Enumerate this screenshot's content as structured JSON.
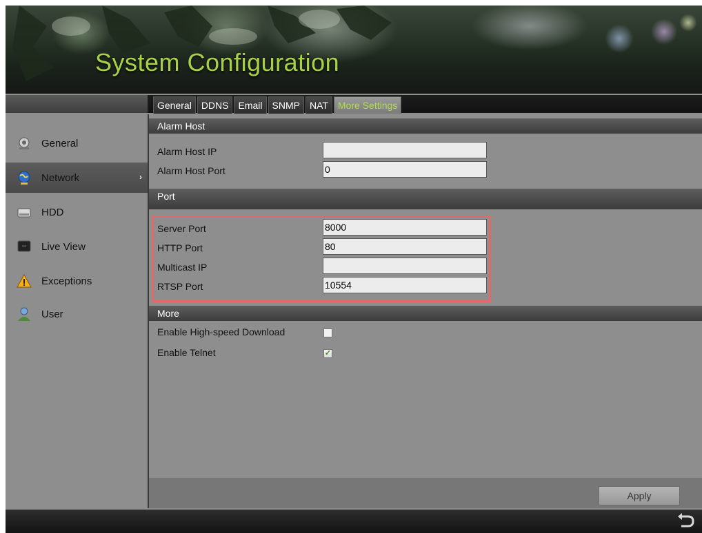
{
  "header": {
    "title": "System Configuration"
  },
  "tabs": [
    {
      "label": "General",
      "active": false
    },
    {
      "label": "DDNS",
      "active": false
    },
    {
      "label": "Email",
      "active": false
    },
    {
      "label": "SNMP",
      "active": false
    },
    {
      "label": "NAT",
      "active": false
    },
    {
      "label": "More Settings",
      "active": true
    }
  ],
  "sidebar": {
    "items": [
      {
        "label": "General",
        "icon": "camera-gear-icon",
        "active": false
      },
      {
        "label": "Network",
        "icon": "globe-icon",
        "active": true,
        "arrow": "›"
      },
      {
        "label": "HDD",
        "icon": "hdd-icon",
        "active": false
      },
      {
        "label": "Live View",
        "icon": "monitor-icon",
        "active": false
      },
      {
        "label": "Exceptions",
        "icon": "warning-icon",
        "active": false
      },
      {
        "label": "User",
        "icon": "user-icon",
        "active": false
      }
    ]
  },
  "sections": {
    "alarm_host": {
      "title": "Alarm Host",
      "ip_label": "Alarm Host IP",
      "ip_value": "",
      "port_label": "Alarm Host Port",
      "port_value": "0"
    },
    "port": {
      "title": "Port",
      "server_port_label": "Server Port",
      "server_port_value": "8000",
      "http_port_label": "HTTP Port",
      "http_port_value": "80",
      "multicast_ip_label": "Multicast IP",
      "multicast_ip_value": "",
      "rtsp_port_label": "RTSP Port",
      "rtsp_port_value": "10554"
    },
    "more": {
      "title": "More",
      "high_speed_download_label": "Enable High-speed Download",
      "high_speed_download_checked": false,
      "telnet_label": "Enable Telnet",
      "telnet_checked": true
    }
  },
  "actions": {
    "apply_label": "Apply"
  },
  "colors": {
    "accent_green": "#a7d246",
    "highlight_red": "#e06a6a"
  }
}
